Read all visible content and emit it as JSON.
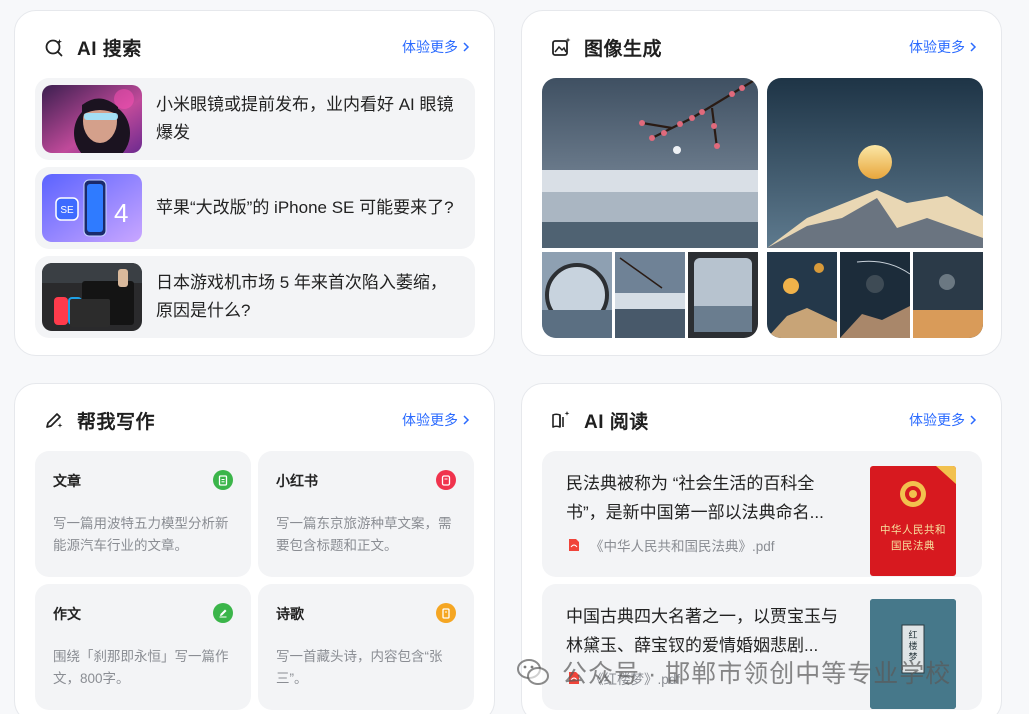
{
  "ai_search": {
    "title": "AI 搜索",
    "more": "体验更多",
    "items": [
      {
        "text": "小米眼镜或提前发布，业内看好 AI 眼镜爆发"
      },
      {
        "text": "苹果“大改版”的 iPhone SE 可能要来了?"
      },
      {
        "text": "日本游戏机市场 5 年来首次陷入萎缩，原因是什么?"
      }
    ]
  },
  "image_gen": {
    "title": "图像生成",
    "more": "体验更多"
  },
  "writing": {
    "title": "帮我写作",
    "more": "体验更多",
    "items": [
      {
        "title": "文章",
        "desc": "写一篇用波特五力模型分析新能源汽车行业的文章。",
        "color": "#3bb54a"
      },
      {
        "title": "小红书",
        "desc": "写一篇东京旅游种草文案，需要包含标题和正文。",
        "color": "#f0334d"
      },
      {
        "title": "作文",
        "desc": "围绕「刹那即永恒」写一篇作文，800字。",
        "color": "#3bb54a"
      },
      {
        "title": "诗歌",
        "desc": "写一首藏头诗，内容包含“张三”。",
        "color": "#f5a623"
      }
    ]
  },
  "reading": {
    "title": "AI 阅读",
    "more": "体验更多",
    "items": [
      {
        "text": "民法典被称为 “社会生活的百科全书”，是新中国第一部以法典命名...",
        "file": "《中华人民共和国民法典》.pdf",
        "book_title": "中华人民共和国民法典"
      },
      {
        "text": "中国古典四大名著之一，以贾宝玉与林黛玉、薛宝钗的爱情婚姻悲剧...",
        "file": "《红楼梦》.pdf",
        "book_title": "红楼梦"
      }
    ]
  },
  "watermark": {
    "text": "公众号 · 邯郸市领创中等专业学校"
  },
  "colors": {
    "accent": "#2b6bff",
    "card_bg": "#ffffff",
    "item_bg": "#f3f4f6"
  }
}
